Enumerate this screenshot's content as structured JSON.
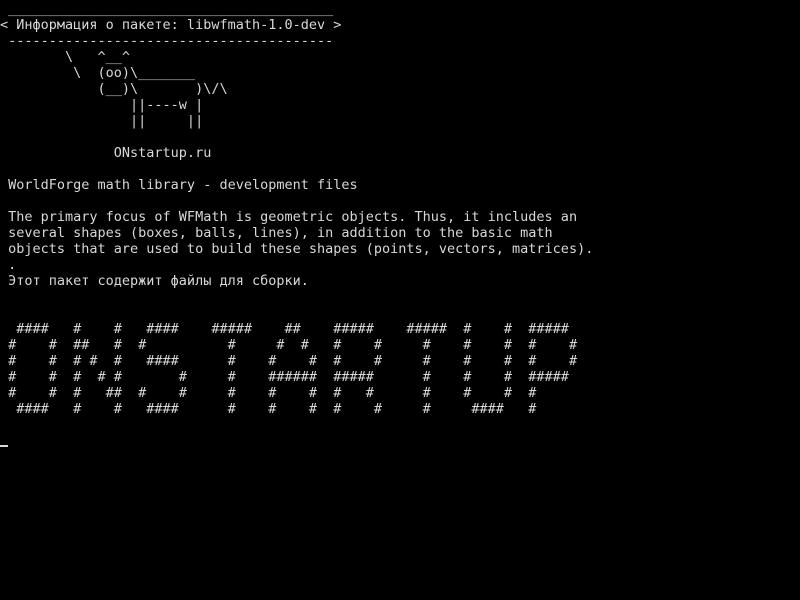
{
  "terminal": {
    "colors": {
      "background": "#000000",
      "foreground": "#d8d8d8"
    },
    "lines": [
      {
        "name": "cowsay-top-border",
        "text": " ________________________________________"
      },
      {
        "name": "cowsay-message",
        "text": "< Информация о пакете: libwfmath-1.0-dev >"
      },
      {
        "name": "cowsay-bottom-border",
        "text": " ----------------------------------------"
      },
      {
        "name": "cow-art-line",
        "text": "        \\   ^__^"
      },
      {
        "name": "cow-art-line",
        "text": "         \\  (oo)\\_______"
      },
      {
        "name": "cow-art-line",
        "text": "            (__)\\       )\\/\\"
      },
      {
        "name": "cow-art-line",
        "text": "                ||----w |"
      },
      {
        "name": "cow-art-line",
        "text": "                ||     ||"
      },
      {
        "name": "blank-line",
        "text": ""
      },
      {
        "name": "site-credit",
        "text": "              ONstartup.ru"
      },
      {
        "name": "blank-line",
        "text": ""
      },
      {
        "name": "package-summary",
        "text": " WorldForge math library - development files"
      },
      {
        "name": "blank-line",
        "text": ""
      },
      {
        "name": "description-line",
        "text": " The primary focus of WFMath is geometric objects. Thus, it includes an"
      },
      {
        "name": "description-line",
        "text": " several shapes (boxes, balls, lines), in addition to the basic math"
      },
      {
        "name": "description-line",
        "text": " objects that are used to build these shapes (points, vectors, matrices)."
      },
      {
        "name": "description-line",
        "text": " ."
      },
      {
        "name": "description-line-ru",
        "text": " Этот пакет содержит файлы для сборки."
      },
      {
        "name": "blank-line",
        "text": ""
      },
      {
        "name": "blank-line",
        "text": ""
      },
      {
        "name": "banner-line",
        "text": "  ####   #    #   ####    #####    ##    #####    #####  #    #  #####"
      },
      {
        "name": "banner-line",
        "text": " #    #  ##   #  #          #     #  #   #    #     #    #    #  #    #"
      },
      {
        "name": "banner-line",
        "text": " #    #  # #  #   ####      #    #    #  #    #     #    #    #  #    #"
      },
      {
        "name": "banner-line",
        "text": " #    #  #  # #       #     #    ######  #####      #    #    #  #####"
      },
      {
        "name": "banner-line",
        "text": " #    #  #   ##  #    #     #    #    #  #   #      #    #    #  #"
      },
      {
        "name": "banner-line",
        "text": "  ####   #    #   ####      #    #    #  #    #     #     ####   #"
      },
      {
        "name": "blank-line",
        "text": ""
      }
    ]
  }
}
